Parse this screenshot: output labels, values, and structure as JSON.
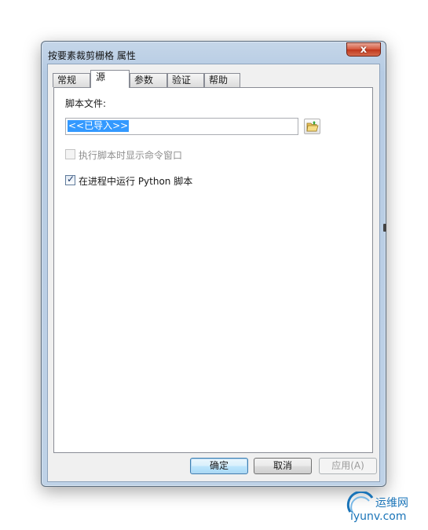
{
  "window": {
    "title": "按要素裁剪栅格 属性",
    "close_label": "x"
  },
  "tabs": [
    {
      "label": "常规"
    },
    {
      "label": "源"
    },
    {
      "label": "参数"
    },
    {
      "label": "验证"
    },
    {
      "label": "帮助"
    }
  ],
  "active_tab": "源",
  "source_panel": {
    "script_file_label": "脚本文件:",
    "script_file_value": "<<已导入>>",
    "show_cmd_window_label": "执行脚本时显示命令窗口",
    "show_cmd_window_checked": false,
    "show_cmd_window_enabled": false,
    "run_in_process_label": "在进程中运行 Python 脚本",
    "run_in_process_checked": true
  },
  "buttons": {
    "ok": "确定",
    "cancel": "取消",
    "apply": "应用(A)"
  },
  "watermark": {
    "name": "运维网",
    "url": "iyunv.com"
  }
}
